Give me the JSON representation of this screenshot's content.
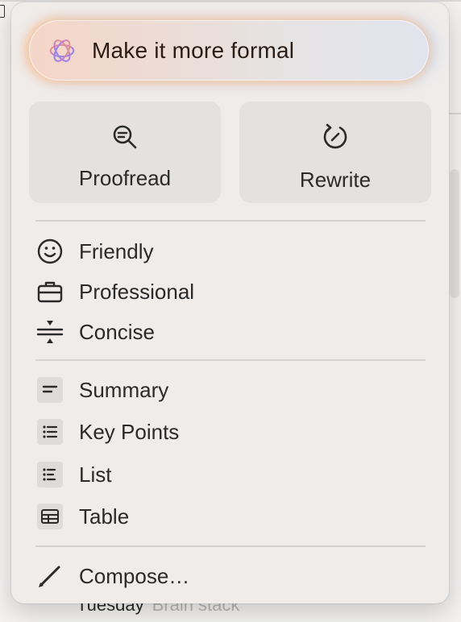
{
  "prompt": {
    "text": "Make it more formal",
    "icon": "sparkle-flower-icon"
  },
  "tools": [
    {
      "label": "Proofread",
      "icon": "magnify-check-icon"
    },
    {
      "label": "Rewrite",
      "icon": "refresh-circle-icon"
    }
  ],
  "tones": [
    {
      "label": "Friendly",
      "icon": "smiley-icon"
    },
    {
      "label": "Professional",
      "icon": "briefcase-icon"
    },
    {
      "label": "Concise",
      "icon": "compress-icon"
    }
  ],
  "formats": [
    {
      "label": "Summary",
      "icon": "summary-lines-icon"
    },
    {
      "label": "Key Points",
      "icon": "bullet-list-icon"
    },
    {
      "label": "List",
      "icon": "list-icon"
    },
    {
      "label": "Table",
      "icon": "table-icon"
    }
  ],
  "compose": {
    "label": "Compose…",
    "icon": "pencil-icon"
  },
  "background": {
    "day": "Tuesday",
    "note": "Brain stack"
  },
  "colors": {
    "panel": "#efecea",
    "button": "#e4e1e0",
    "text": "#2a2a2a",
    "glow_warm": "#ffbe78",
    "glow_cool": "#8cb4ff"
  }
}
